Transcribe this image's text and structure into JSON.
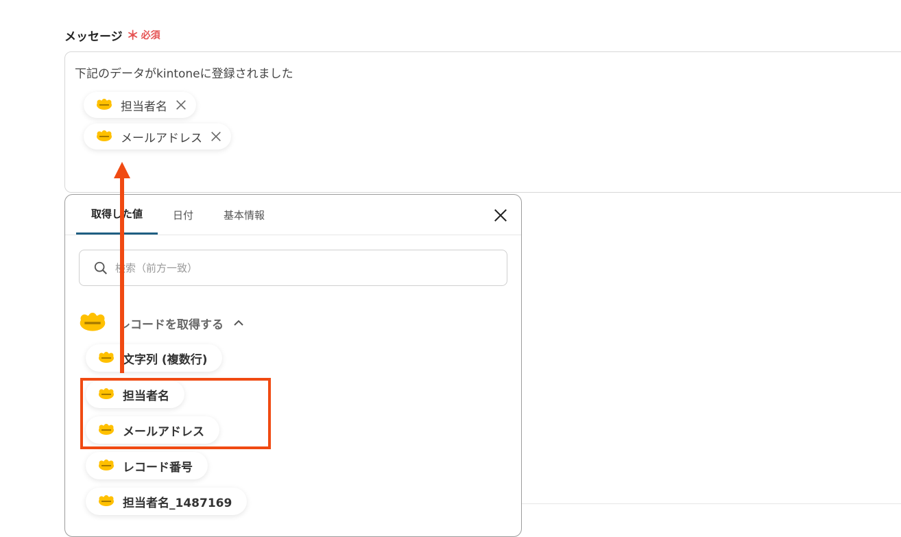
{
  "field": {
    "label": "メッセージ",
    "required_mark": "＊",
    "required_text": "必須"
  },
  "message": {
    "text": "下記のデータがkintoneに登録されました",
    "chips": [
      {
        "label": "担当者名",
        "icon": "kintone-logo"
      },
      {
        "label": "メールアドレス",
        "icon": "kintone-logo"
      }
    ]
  },
  "panel": {
    "tabs": [
      {
        "label": "取得した値",
        "active": true
      },
      {
        "label": "日付"
      },
      {
        "label": "基本情報"
      }
    ],
    "search_placeholder": "検索（前方一致）",
    "group": {
      "title": "レコードを取得する",
      "items": [
        {
          "label": "文字列 (複数行)"
        },
        {
          "label": "担当者名"
        },
        {
          "label": "メールアドレス"
        },
        {
          "label": "レコード番号"
        },
        {
          "label": "担当者名_1487169"
        }
      ]
    }
  },
  "colors": {
    "accent": "#1f5f82",
    "highlight": "#f04a12",
    "required": "#e55353",
    "kintone": "#ffc000"
  }
}
